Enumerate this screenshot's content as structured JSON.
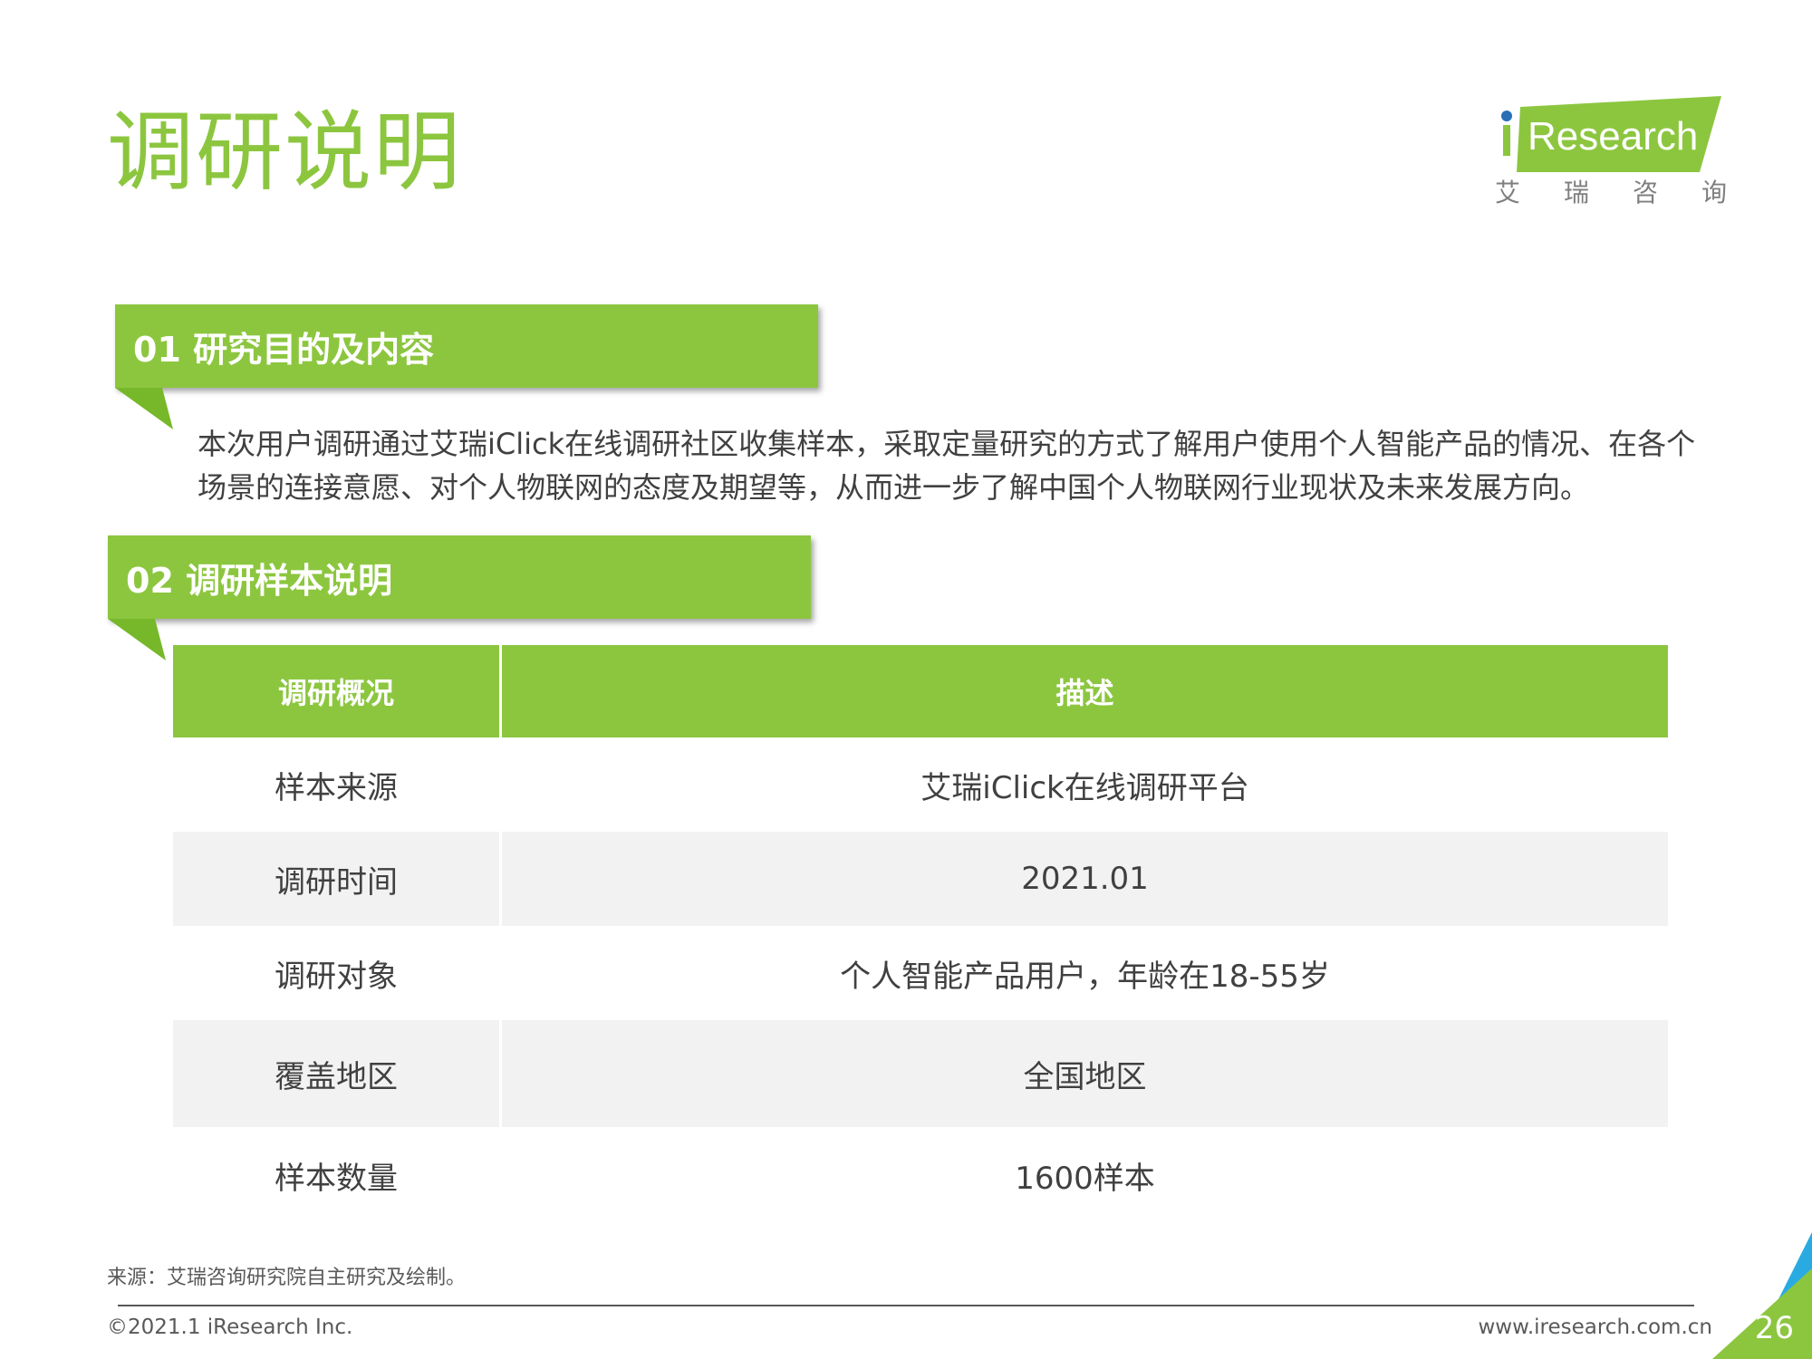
{
  "header": {
    "title": "调研说明"
  },
  "logo": {
    "wordmark": "Research",
    "chars": [
      "艾",
      "瑞",
      "咨",
      "询"
    ]
  },
  "sections": [
    {
      "label": "01 研究目的及内容"
    },
    {
      "label": "02 调研样本说明"
    }
  ],
  "intro": {
    "text": "本次用户调研通过艾瑞iClick在线调研社区收集样本，采取定量研究的方式了解用户使用个人智能产品的情况、在各个场景的连接意愿、对个人物联网的态度及期望等，从而进一步了解中国个人物联网行业现状及未来发展方向。"
  },
  "table": {
    "headers": [
      "调研概况",
      "描述"
    ],
    "rows": [
      [
        "样本来源",
        "艾瑞iClick在线调研平台"
      ],
      [
        "调研时间",
        "2021.01"
      ],
      [
        "调研对象",
        "个人智能产品用户，年龄在18-55岁"
      ],
      [
        "覆盖地区",
        "全国地区"
      ],
      [
        "样本数量",
        "1600样本"
      ]
    ]
  },
  "footer": {
    "source": "来源：艾瑞咨询研究院自主研究及绘制。",
    "copyright": "©2021.1 iResearch Inc.",
    "website": "www.iresearch.com.cn",
    "page_number": "26"
  },
  "colors": {
    "accent": "#8cc63f",
    "text": "#404040",
    "row_alt": "#f2f2f2",
    "logo_dot": "#2a6fb6",
    "corner_blue": "#29abe2"
  }
}
